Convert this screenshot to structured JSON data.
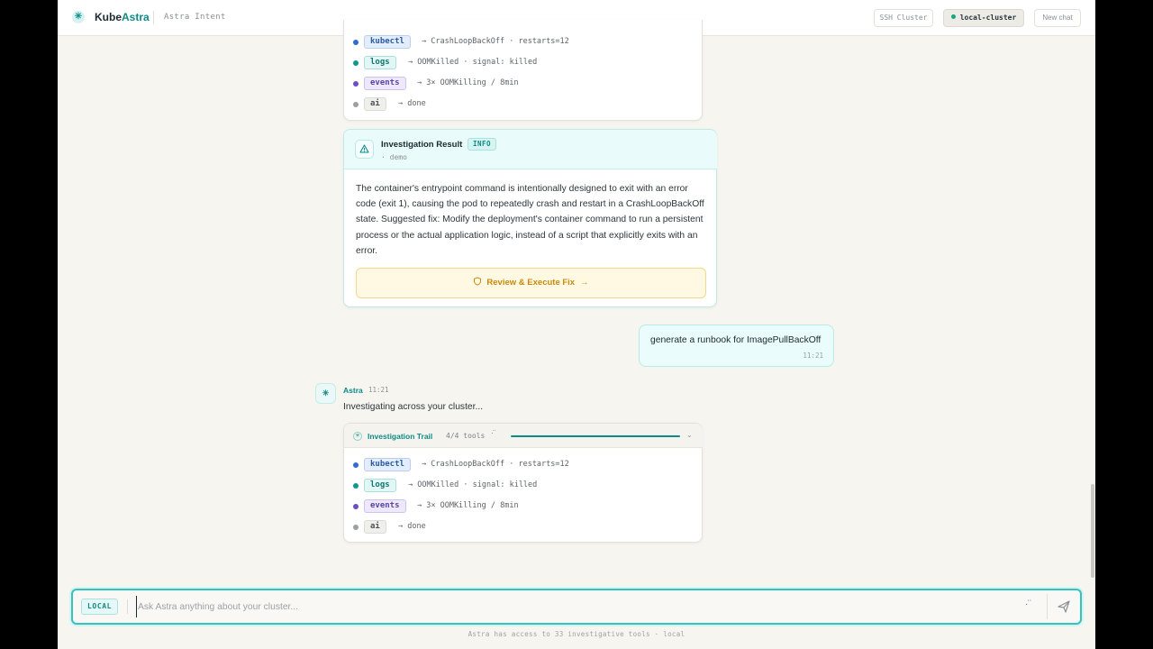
{
  "header": {
    "brand_prefix": "Kube",
    "brand_accent": "Astra",
    "subtitle": "Astra Intent",
    "ssh_button": "SSH Cluster",
    "cluster_button": "local-cluster",
    "new_chat_button": "New chat"
  },
  "trail_top": {
    "tools": [
      {
        "tag": "kubectl",
        "result": "→ CrashLoopBackOff · restarts=12"
      },
      {
        "tag": "logs",
        "result": "→ OOMKilled · signal: killed"
      },
      {
        "tag": "events",
        "result": "→ 3× OOMKilling / 8min"
      },
      {
        "tag": "ai",
        "result": "→ done"
      }
    ]
  },
  "result": {
    "title": "Investigation Result",
    "badge": "INFO",
    "sub": "· demo",
    "body": "The container's entrypoint command is intentionally designed to exit with an error code (exit 1), causing the pod to repeatedly crash and restart in a CrashLoopBackOff state. Suggested fix: Modify the deployment's container command to run a persistent process or the actual application logic, instead of a script that explicitly exits with an error.",
    "fix_button": "Review & Execute Fix"
  },
  "user_message": {
    "text": "generate a runbook for ImagePullBackOff",
    "time": "11:21"
  },
  "astra_message": {
    "name": "Astra",
    "time": "11:21",
    "text": "Investigating across your cluster...",
    "trail": {
      "title": "Investigation Trail",
      "count": "4/4 tools",
      "tools": [
        {
          "tag": "kubectl",
          "result": "→ CrashLoopBackOff · restarts=12"
        },
        {
          "tag": "logs",
          "result": "→ OOMKilled · signal: killed"
        },
        {
          "tag": "events",
          "result": "→ 3× OOMKilling / 8min"
        },
        {
          "tag": "ai",
          "result": "→ done"
        }
      ]
    }
  },
  "input": {
    "badge": "LOCAL",
    "placeholder": "Ask Astra anything about your cluster..."
  },
  "footer": {
    "note": "Astra has access to 33 investigative tools · local"
  },
  "colors": {
    "accent": "#0d8b86",
    "kubectl_dot": "#2f6bd1",
    "logs_dot": "#13978d",
    "events_dot": "#6a4fc5",
    "ai_dot": "#9aa0a3",
    "fix_text": "#c88a0c"
  },
  "icons": {
    "logo": "asterisk-icon",
    "result": "warning-triangle-icon",
    "fix": "shield-icon",
    "send": "paper-plane-icon"
  }
}
